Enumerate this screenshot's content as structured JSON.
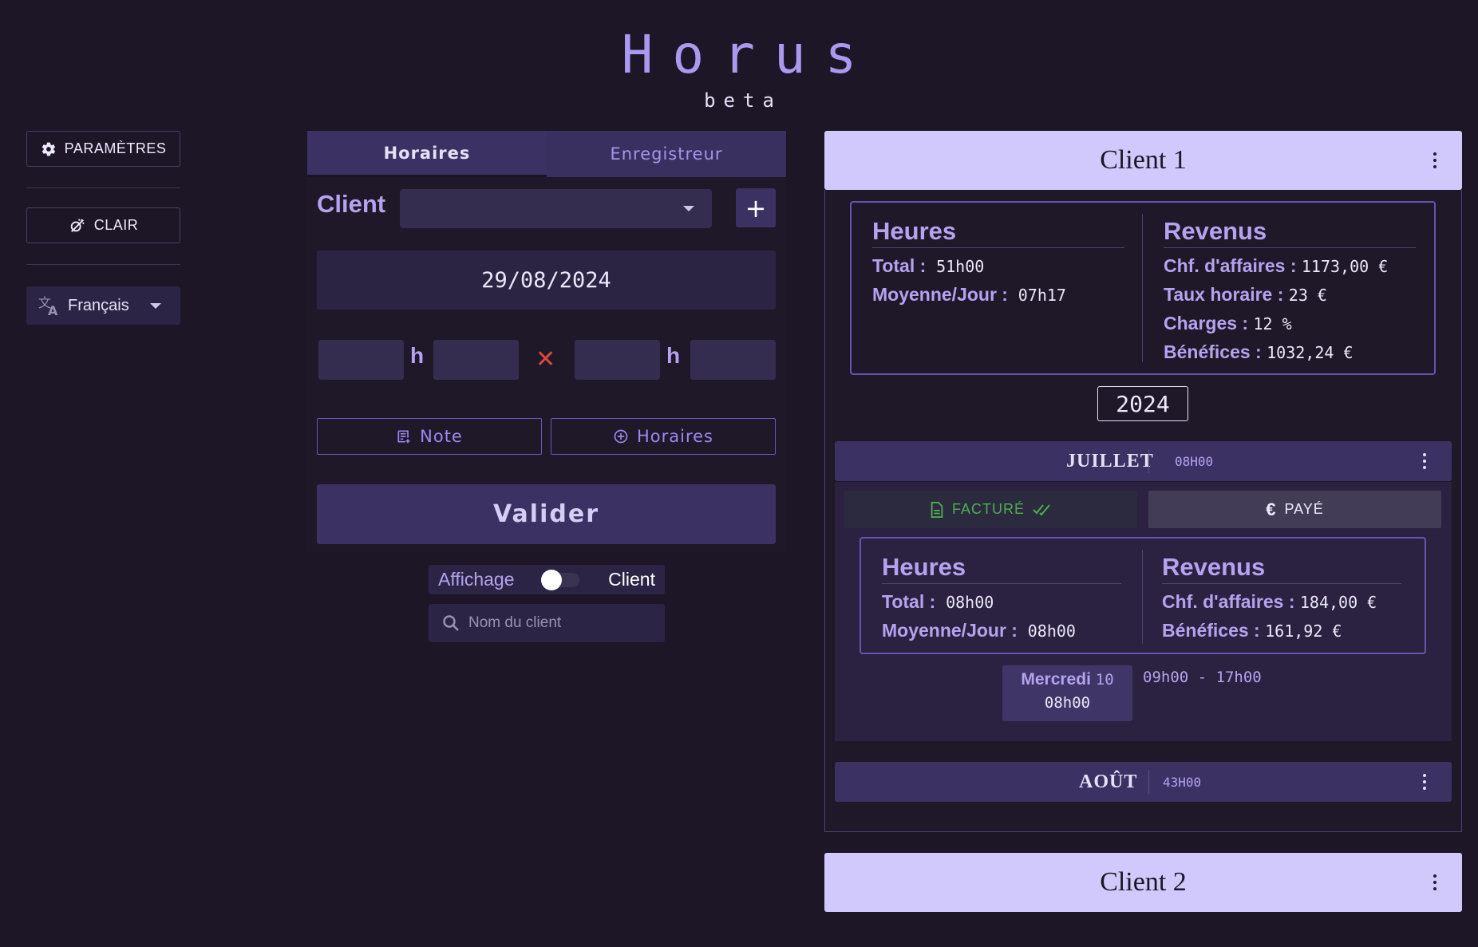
{
  "header": {
    "title": "Horus",
    "subtitle": "beta"
  },
  "sidebar": {
    "settings_label": "PARAMÈTRES",
    "theme_label": "CLAIR",
    "language_label": "Français"
  },
  "form": {
    "tabs": [
      "Horaires",
      "Enregistreur"
    ],
    "client_label": "Client",
    "client_value": "",
    "add_label": "+",
    "date": "29/08/2024",
    "hour_sep": "h",
    "clear_symbol": "✕",
    "note_label": "Note",
    "hours_label": "Horaires",
    "validate_label": "Valider",
    "toggle_left": "Affichage",
    "toggle_right": "Client",
    "search_placeholder": "Nom du client"
  },
  "clients": [
    {
      "name": "Client 1",
      "hours_title": "Heures",
      "revenue_title": "Revenus",
      "total_label": "Total :",
      "total_value": "51h00",
      "avg_label": "Moyenne/Jour :",
      "avg_value": "07h17",
      "turnover_label": "Chf. d'affaires :",
      "turnover_value": "1173,00 €",
      "rate_label": "Taux horaire :",
      "rate_value": "23 €",
      "charges_label": "Charges :",
      "charges_value": "12 %",
      "profit_label": "Bénéfices :",
      "profit_value": "1032,24 €",
      "year": "2024",
      "months": [
        {
          "name": "JUILLET",
          "hours": "08H00",
          "invoiced_label": "FACTURÉ",
          "paid_label": "PAYÉ",
          "hours_title": "Heures",
          "revenue_title": "Revenus",
          "total_label": "Total :",
          "total_value": "08h00",
          "avg_label": "Moyenne/Jour :",
          "avg_value": "08h00",
          "turnover_label": "Chf. d'affaires :",
          "turnover_value": "184,00 €",
          "profit_label": "Bénéfices :",
          "profit_value": "161,92 €",
          "day": {
            "weekday": "Mercredi",
            "date": "10",
            "hours": "08h00",
            "range": "09h00 - 17h00"
          }
        },
        {
          "name": "AOÛT",
          "hours": "43H00"
        }
      ]
    },
    {
      "name": "Client 2"
    }
  ],
  "colors": {
    "background": "#1c1626",
    "accent": "#3c3163",
    "client_header": "#d1c9fc",
    "invoiced": "#4caf50",
    "clear_icon": "#e0473b"
  }
}
